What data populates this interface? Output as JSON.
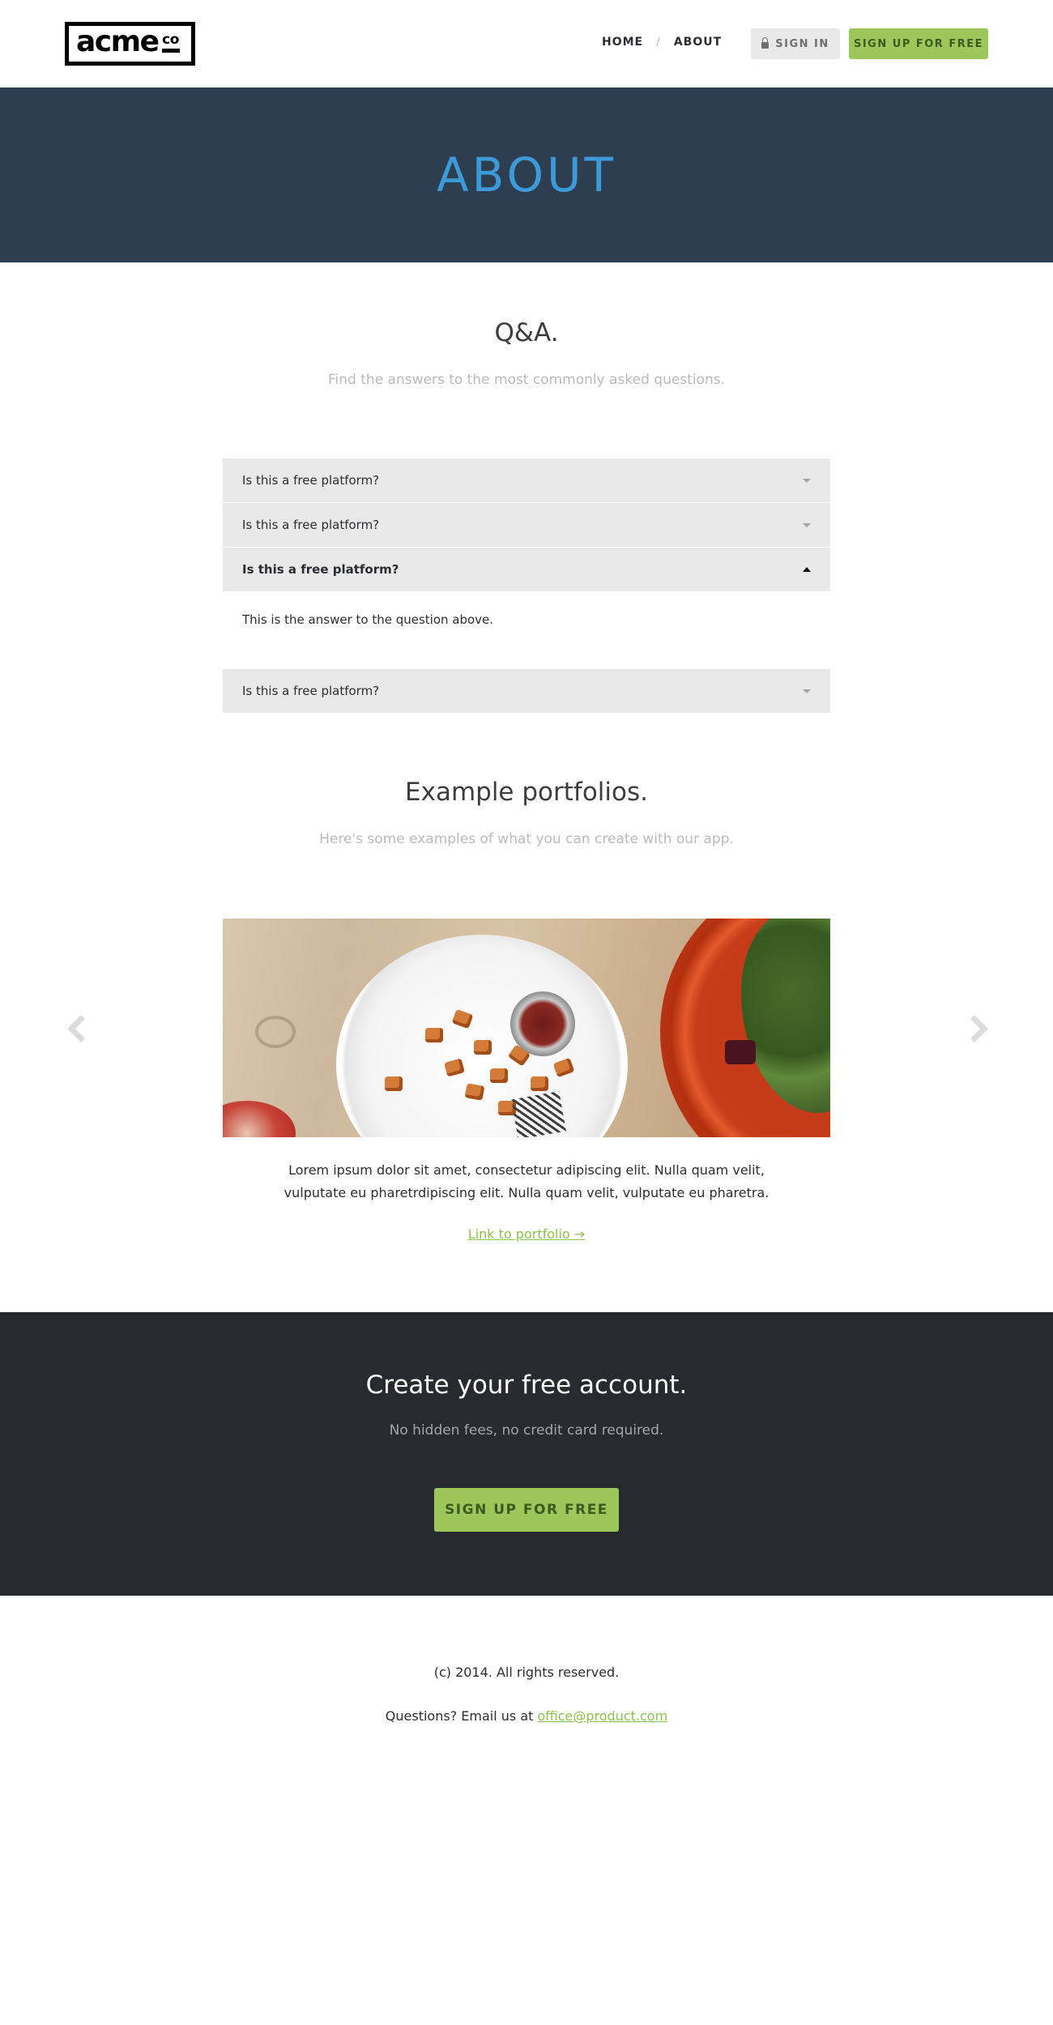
{
  "header": {
    "logo_text": "acme",
    "logo_suffix": "co",
    "nav": [
      {
        "label": "HOME"
      },
      {
        "label": "ABOUT"
      }
    ],
    "nav_separator": "/",
    "signin_label": "SIGN IN",
    "signup_label": "SIGN UP FOR FREE"
  },
  "hero": {
    "title": "ABOUT"
  },
  "qa": {
    "title": "Q&A.",
    "subtitle": "Find the answers to the most commonly asked questions.",
    "items": [
      {
        "question": "Is this a free platform?",
        "open": false
      },
      {
        "question": "Is this a free platform?",
        "open": false
      },
      {
        "question": "Is this a free platform?",
        "open": true,
        "answer": "This is the answer to the question above."
      },
      {
        "question": "Is this a free platform?",
        "open": false
      }
    ]
  },
  "portfolios": {
    "title": "Example portfolios.",
    "subtitle": "Here's some examples of what you can create with our app.",
    "description": "Lorem ipsum dolor sit amet, consectetur adipiscing elit. Nulla quam velit, vulputate eu pharetrdipiscing elit. Nulla quam velit, vulputate eu pharetra.",
    "link_label": "Link to portfolio →"
  },
  "cta": {
    "title": "Create your free account.",
    "subtitle": "No hidden fees, no credit card required.",
    "button_label": "SIGN UP FOR FREE"
  },
  "footer": {
    "copyright": "(c) 2014. All rights reserved.",
    "email_prefix": "Questions? Email us at ",
    "email": "office@product.com"
  },
  "colors": {
    "hero_bg": "#2d3e50",
    "hero_title": "#3d9ad8",
    "accent_green": "#9bc75b",
    "cta_bg": "#272b2f",
    "faq_bg": "#e9e9e9"
  }
}
